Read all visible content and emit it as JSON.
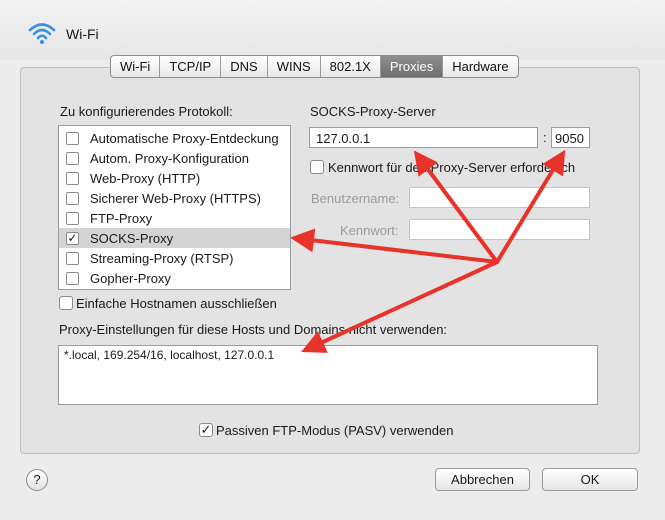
{
  "window": {
    "title": "Wi-Fi"
  },
  "tabs": [
    {
      "label": "Wi-Fi",
      "active": false
    },
    {
      "label": "TCP/IP",
      "active": false
    },
    {
      "label": "DNS",
      "active": false
    },
    {
      "label": "WINS",
      "active": false
    },
    {
      "label": "802.1X",
      "active": false
    },
    {
      "label": "Proxies",
      "active": true
    },
    {
      "label": "Hardware",
      "active": false
    }
  ],
  "protocol": {
    "heading": "Zu konfigurierendes Protokoll:",
    "items": [
      {
        "label": "Automatische Proxy-Entdeckung",
        "checked": false
      },
      {
        "label": "Autom. Proxy-Konfiguration",
        "checked": false
      },
      {
        "label": "Web-Proxy (HTTP)",
        "checked": false
      },
      {
        "label": "Sicherer Web-Proxy (HTTPS)",
        "checked": false
      },
      {
        "label": "FTP-Proxy",
        "checked": false
      },
      {
        "label": "SOCKS-Proxy",
        "checked": true,
        "selected": true
      },
      {
        "label": "Streaming-Proxy (RTSP)",
        "checked": false
      },
      {
        "label": "Gopher-Proxy",
        "checked": false
      }
    ]
  },
  "server": {
    "heading": "SOCKS-Proxy-Server",
    "host": "127.0.0.1",
    "separator": ":",
    "port": "9050",
    "password_required": "Kennwort für den Proxy-Server erforderlich",
    "username_label": "Benutzername:",
    "password_label": "Kennwort:",
    "username_value": "",
    "password_value": ""
  },
  "exclude_simple_hostnames": "Einfache Hostnamen ausschließen",
  "bypass": {
    "heading": "Proxy-Einstellungen für diese Hosts und Domains nicht verwenden:",
    "value": "*.local, 169.254/16, localhost, 127.0.0.1"
  },
  "passive_ftp": {
    "label": "Passiven FTP-Modus (PASV) verwenden",
    "checked": true
  },
  "buttons": {
    "help": "?",
    "cancel": "Abbrechen",
    "ok": "OK"
  },
  "annotation_color": "#e8332a"
}
